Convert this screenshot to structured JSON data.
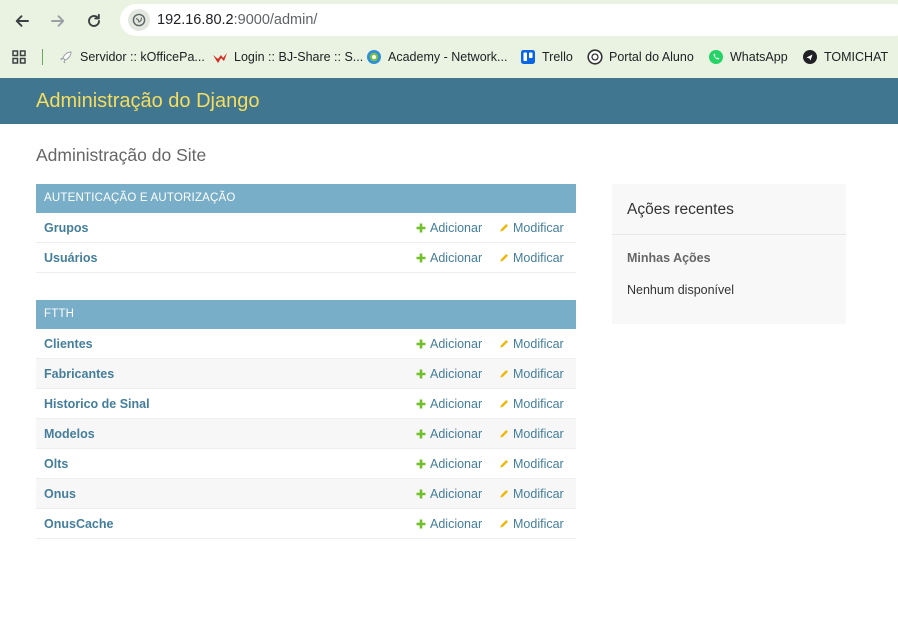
{
  "browser": {
    "url_host": "192.16.80.2",
    "url_rest": ":9000/admin/",
    "nav": {
      "back_icon": "back-arrow-icon",
      "forward_icon": "forward-arrow-icon",
      "reload_icon": "reload-icon"
    },
    "bookmarks": [
      {
        "label": "Servidor :: kOfficePa...",
        "icon": "rocket-icon"
      },
      {
        "label": "Login :: BJ-Share :: S...",
        "icon": "bj-share-icon"
      },
      {
        "label": "Academy - Network...",
        "icon": "academy-icon"
      },
      {
        "label": "Trello",
        "icon": "trello-icon"
      },
      {
        "label": "Portal do Aluno",
        "icon": "portal-icon"
      },
      {
        "label": "WhatsApp",
        "icon": "whatsapp-icon"
      },
      {
        "label": "TOMICHAT",
        "icon": "tomichat-icon"
      }
    ]
  },
  "header": {
    "brand": "Administração do Django"
  },
  "page": {
    "title": "Administração do Site"
  },
  "apps": [
    {
      "caption": "AUTENTICAÇÃO E AUTORIZAÇÃO",
      "models": [
        {
          "name": "Grupos",
          "add": "Adicionar",
          "change": "Modificar"
        },
        {
          "name": "Usuários",
          "add": "Adicionar",
          "change": "Modificar"
        }
      ]
    },
    {
      "caption": "FTTH",
      "models": [
        {
          "name": "Clientes",
          "add": "Adicionar",
          "change": "Modificar"
        },
        {
          "name": "Fabricantes",
          "add": "Adicionar",
          "change": "Modificar"
        },
        {
          "name": "Historico de Sinal",
          "add": "Adicionar",
          "change": "Modificar"
        },
        {
          "name": "Modelos",
          "add": "Adicionar",
          "change": "Modificar"
        },
        {
          "name": "Olts",
          "add": "Adicionar",
          "change": "Modificar"
        },
        {
          "name": "Onus",
          "add": "Adicionar",
          "change": "Modificar"
        },
        {
          "name": "OnusCache",
          "add": "Adicionar",
          "change": "Modificar"
        }
      ]
    }
  ],
  "recent_actions": {
    "title": "Ações recentes",
    "subtitle": "Minhas Ações",
    "empty": "Nenhum disponível"
  },
  "colors": {
    "header_bg": "#417690",
    "brand": "#f5dd5d",
    "caption_bg": "#79aec8",
    "link": "#447e9b",
    "add_icon": "#70bf2b",
    "change_icon": "#efb80b"
  }
}
